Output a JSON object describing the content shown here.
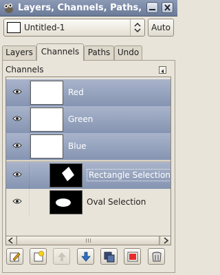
{
  "window": {
    "title": "Layers, Channels, Paths, Undo",
    "app_icon": "gimp-wilber-icon",
    "buttons": [
      "minimize-icon",
      "close-icon"
    ]
  },
  "image_selector": {
    "value": "Untitled-1",
    "auto_label": "Auto"
  },
  "tabs": [
    {
      "label": "Layers",
      "active": false
    },
    {
      "label": "Channels",
      "active": true
    },
    {
      "label": "Paths",
      "active": false
    },
    {
      "label": "Undo",
      "active": false
    }
  ],
  "panel": {
    "title": "Channels",
    "menu_icon": "tab-menu-arrow-icon"
  },
  "channels": {
    "color": [
      {
        "name": "Red",
        "visible": true,
        "selected": true
      },
      {
        "name": "Green",
        "visible": true,
        "selected": true
      },
      {
        "name": "Blue",
        "visible": true,
        "selected": true
      }
    ],
    "custom": [
      {
        "name": "Rectangle Selection",
        "visible": true,
        "selected": true,
        "thumb_shape": "rotated-rectangle"
      },
      {
        "name": "Oval Selection",
        "visible": true,
        "selected": false,
        "thumb_shape": "ellipse"
      }
    ]
  },
  "toolbar": [
    {
      "name": "edit-channel-attributes-icon",
      "enabled": true
    },
    {
      "name": "new-channel-icon",
      "enabled": true
    },
    {
      "name": "raise-channel-icon",
      "enabled": false
    },
    {
      "name": "lower-channel-icon",
      "enabled": true
    },
    {
      "name": "duplicate-channel-icon",
      "enabled": true
    },
    {
      "name": "channel-to-selection-icon",
      "enabled": true
    },
    {
      "name": "delete-channel-icon",
      "enabled": true
    }
  ],
  "colors": {
    "selection": "#8594b2",
    "titlebar": "#7685a3",
    "background": "#e9e4d9"
  }
}
